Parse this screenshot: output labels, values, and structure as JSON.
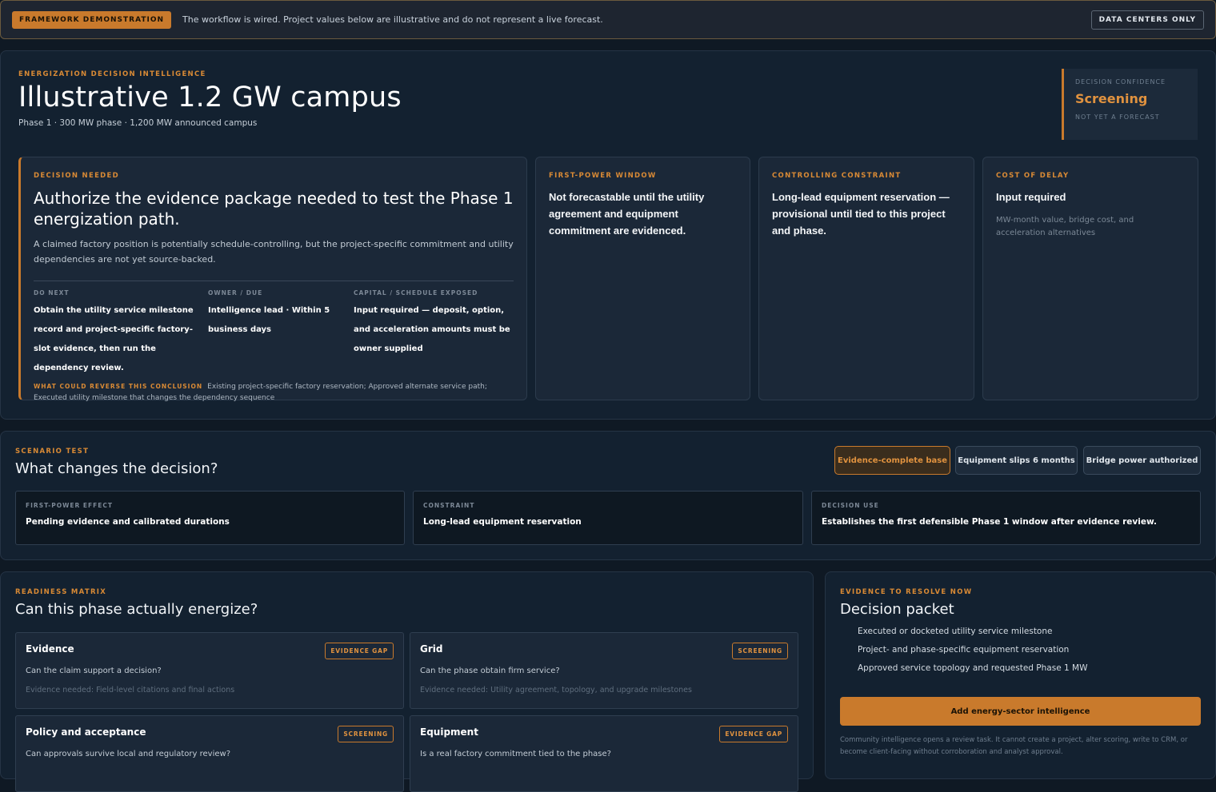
{
  "banner": {
    "tag": "FRAMEWORK DEMONSTRATION",
    "text": "The workflow is wired. Project values below are illustrative and do not represent a live forecast.",
    "button": "DATA CENTERS ONLY"
  },
  "hero": {
    "eyebrow": "ENERGIZATION DECISION INTELLIGENCE",
    "title": "Illustrative 1.2 GW campus",
    "subtitle": "Phase 1 · 300 MW phase · 1,200 MW announced campus",
    "confidence": {
      "label": "DECISION CONFIDENCE",
      "value": "Screening",
      "note": "NOT YET A FORECAST"
    }
  },
  "decision": {
    "eyebrow": "DECISION NEEDED",
    "title": "Authorize the evidence package needed to test the Phase 1 energization path.",
    "text": "A claimed factory position is potentially schedule-controlling, but the project-specific commitment and utility dependencies are not yet source-backed.",
    "do_next_label": "DO NEXT",
    "do_next": "Obtain the utility service milestone record and project-specific factory-slot evidence, then run the dependency review.",
    "owner_label": "OWNER / DUE",
    "owner": "Intelligence lead · Within 5 business days",
    "capital_label": "CAPITAL / SCHEDULE EXPOSED",
    "capital": "Input required — deposit, option, and acceleration amounts must be owner supplied",
    "reverse_label": "WHAT COULD REVERSE THIS CONCLUSION",
    "reverse": "Existing project-specific factory reservation; Approved alternate service path; Executed utility milestone that changes the dependency sequence"
  },
  "cards": [
    {
      "eyebrow": "FIRST-POWER WINDOW",
      "head": "Not forecastable until the utility agreement and equipment commitment are evidenced.",
      "body": ""
    },
    {
      "eyebrow": "CONTROLLING CONSTRAINT",
      "head": "Long-lead equipment reservation — provisional until tied to this project and phase.",
      "body": ""
    },
    {
      "eyebrow": "COST OF DELAY",
      "head": "Input required",
      "body": "MW-month value, bridge cost, and acceleration alternatives"
    }
  ],
  "scenario": {
    "eyebrow": "SCENARIO TEST",
    "title": "What changes the decision?",
    "buttons": [
      "Evidence-complete base",
      "Equipment slips 6 months",
      "Bridge power authorized"
    ],
    "boxes": [
      {
        "label": "FIRST-POWER EFFECT",
        "value": "Pending evidence and calibrated durations"
      },
      {
        "label": "CONSTRAINT",
        "value": "Long-lead equipment reservation"
      },
      {
        "label": "DECISION USE",
        "value": "Establishes the first defensible Phase 1 window after evidence review."
      }
    ]
  },
  "matrix": {
    "eyebrow": "READINESS MATRIX",
    "title": "Can this phase actually energize?",
    "cards": [
      {
        "title": "Evidence",
        "badge": "EVIDENCE GAP",
        "question": "Can the claim support a decision?",
        "evidence": "Evidence needed: Field-level citations and final actions"
      },
      {
        "title": "Grid",
        "badge": "SCREENING",
        "question": "Can the phase obtain firm service?",
        "evidence": "Evidence needed: Utility agreement, topology, and upgrade milestones"
      },
      {
        "title": "Policy and acceptance",
        "badge": "SCREENING",
        "question": "Can approvals survive local and regulatory review?",
        "evidence": ""
      },
      {
        "title": "Equipment",
        "badge": "EVIDENCE GAP",
        "question": "Is a real factory commitment tied to the phase?",
        "evidence": ""
      }
    ]
  },
  "packet": {
    "eyebrow": "EVIDENCE TO RESOLVE NOW",
    "title": "Decision packet",
    "items": [
      "Executed or docketed utility service milestone",
      "Project- and phase-specific equipment reservation",
      "Approved service topology and requested Phase 1 MW"
    ],
    "button": "Add energy-sector intelligence",
    "note": "Community intelligence opens a review task. It cannot create a project, alter scoring, write to CRM, or become client-facing without corroboration and analyst approval."
  }
}
